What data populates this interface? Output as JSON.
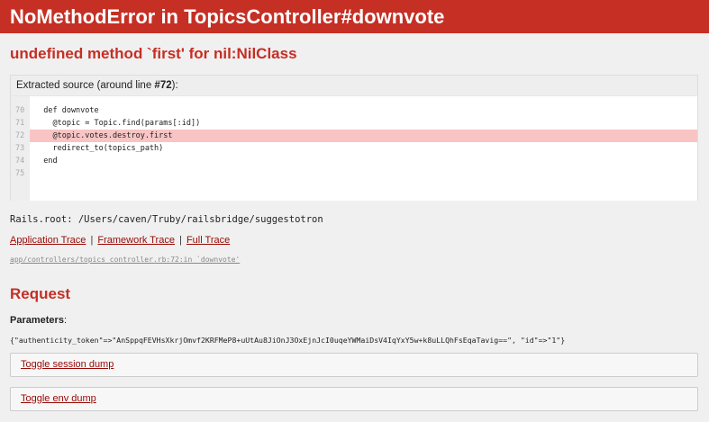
{
  "header": {
    "title": "NoMethodError in TopicsController#downvote"
  },
  "error": {
    "message": "undefined method `first' for nil:NilClass"
  },
  "source": {
    "header_prefix": "Extracted source (around line ",
    "header_line": "#72",
    "header_suffix": "):",
    "lines": [
      {
        "number": "70",
        "code": "  def downvote",
        "highlight": false
      },
      {
        "number": "71",
        "code": "    @topic = Topic.find(params[:id])",
        "highlight": false
      },
      {
        "number": "72",
        "code": "    @topic.votes.destroy.first",
        "highlight": true
      },
      {
        "number": "73",
        "code": "    redirect_to(topics_path)",
        "highlight": false
      },
      {
        "number": "74",
        "code": "  end",
        "highlight": false
      },
      {
        "number": "75",
        "code": "",
        "highlight": false
      }
    ]
  },
  "rails_root": "Rails.root: /Users/caven/Truby/railsbridge/suggestotron",
  "trace": {
    "application": "Application Trace",
    "framework": "Framework Trace",
    "full": "Full Trace",
    "separator": "|",
    "line": "app/controllers/topics_controller.rb:72:in `downvote'"
  },
  "request": {
    "title": "Request",
    "params_label": "Parameters",
    "params_colon": ":",
    "params_value": "{\"authenticity_token\"=>\"AnSppqFEVHsXkrjOmvf2KRFMeP8+uUtAu8JiOnJ3OxEjnJcI0uqeYWMaiDsV4IqYxY5w+k8uLLQhFsEqaTavig==\", \"id\"=>\"1\"}"
  },
  "dumps": {
    "session": "Toggle session dump",
    "env": "Toggle env dump"
  },
  "colors": {
    "header_bg": "#c52f24",
    "link": "#980905",
    "highlight": "#f8c4c4"
  }
}
